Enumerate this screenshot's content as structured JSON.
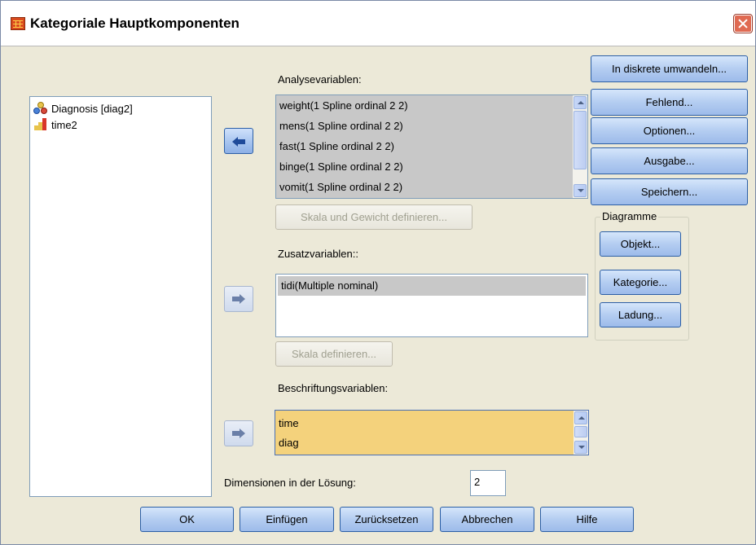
{
  "window": {
    "title": "Kategoriale Hauptkomponenten"
  },
  "source_list": {
    "items": [
      {
        "label": "Diagnosis [diag2]",
        "icon": "nominal-variable-icon"
      },
      {
        "label": "time2",
        "icon": "scale-variable-icon"
      }
    ]
  },
  "analysis": {
    "label": "Analysevariablen:",
    "items": [
      "weight(1 Spline ordinal 2 2)",
      "mens(1 Spline ordinal 2 2)",
      "fast(1 Spline ordinal 2 2)",
      "binge(1 Spline ordinal 2 2)",
      "vomit(1 Spline ordinal 2 2)"
    ],
    "define_button": "Skala und Gewicht definieren..."
  },
  "supplementary": {
    "label": "Zusatzvariablen::",
    "items": [
      "tidi(Multiple nominal)"
    ],
    "define_button": "Skala definieren..."
  },
  "labeling": {
    "label": "Beschriftungsvariablen:",
    "items": [
      "time",
      "diag"
    ]
  },
  "side_buttons": {
    "discretize": "In diskrete umwandeln...",
    "missing": "Fehlend...",
    "options": "Optionen...",
    "output": "Ausgabe...",
    "save": "Speichern..."
  },
  "plots": {
    "legend": "Diagramme",
    "object": "Objekt...",
    "category": "Kategorie...",
    "loading": "Ladung..."
  },
  "dimensions": {
    "label": "Dimensionen in der Lösung:",
    "value": "2"
  },
  "footer": {
    "ok": "OK",
    "paste": "Einfügen",
    "reset": "Zurücksetzen",
    "cancel": "Abbrechen",
    "help": "Hilfe"
  },
  "colors": {
    "dialog_bg": "#ece9d8",
    "selected_gray": "#c8c8c8",
    "label_list_bg": "#f4d27c",
    "button_border": "#003c74",
    "arrow_blue": "#2c5fa6"
  }
}
